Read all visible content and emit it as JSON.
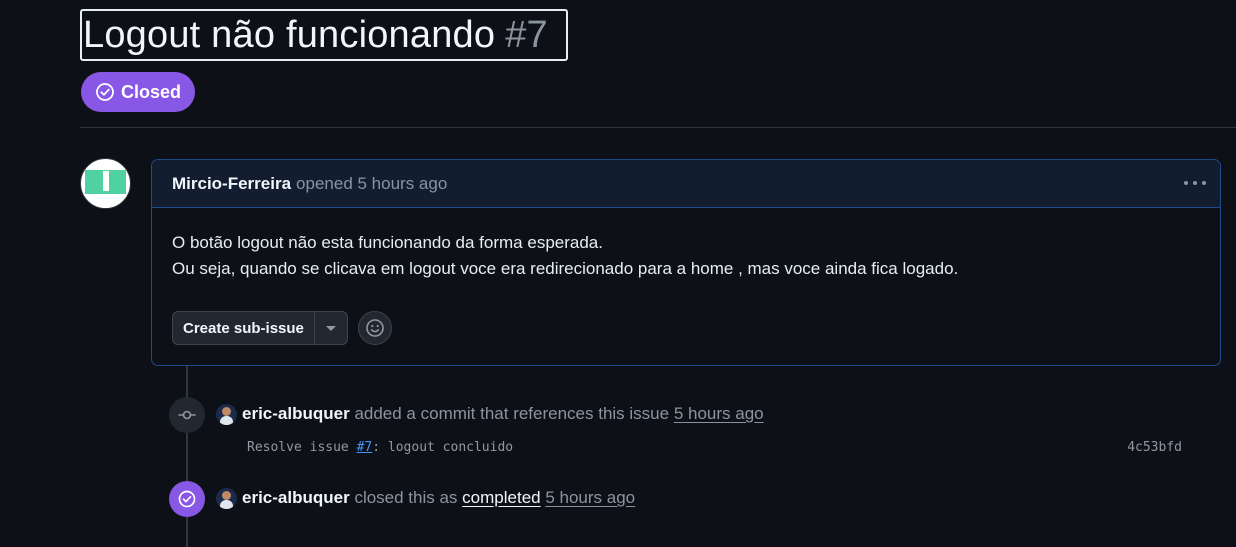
{
  "issue": {
    "title": "Logout não funcionando",
    "number": "#7",
    "state": "Closed",
    "state_color": "#8957e5"
  },
  "comment": {
    "author": "Mircio-Ferreira",
    "meta": "opened 5 hours ago",
    "body_lines": [
      "O botão logout não esta funcionando da forma esperada.",
      "Ou seja, quando se clicava em logout voce era redirecionado para a home , mas voce ainda fica logado."
    ],
    "create_sub_issue_label": "Create sub-issue",
    "menu_icon": "kebab-horizontal-icon",
    "reaction_icon": "smiley-icon"
  },
  "timeline": {
    "commit_event": {
      "user": "eric-albuquer",
      "action": "added a commit that references this issue",
      "time": "5 hours ago",
      "commit_prefix": "Resolve issue",
      "commit_ref": "#7",
      "commit_suffix": ": logout concluido",
      "commit_sha": "4c53bfd",
      "icon": "git-commit-icon"
    },
    "closed_event": {
      "user": "eric-albuquer",
      "action": "closed this as",
      "reason": "completed",
      "time": "5 hours ago",
      "icon": "issue-closed-icon"
    }
  }
}
